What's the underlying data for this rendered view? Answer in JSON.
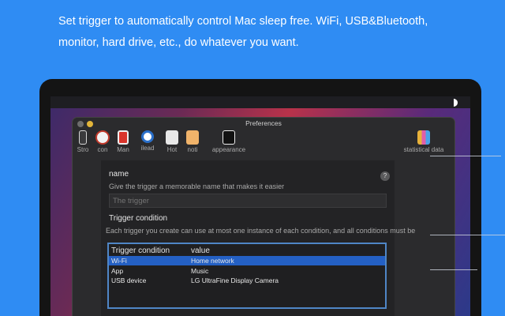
{
  "headline": "Set trigger to automatically control Mac sleep free. WiFi, USB&Bluetooth, monitor, hard drive, etc., do whatever you want.",
  "window": {
    "title": "Preferences"
  },
  "toolbar": {
    "items": [
      {
        "label": "Stro",
        "icon": "phone-icon"
      },
      {
        "label": "con",
        "icon": "clock-icon"
      },
      {
        "label": "Man",
        "icon": "power-icon"
      },
      {
        "label": "ilead",
        "icon": "search-icon"
      },
      {
        "label": "Hot",
        "icon": "keyboard-icon"
      },
      {
        "label": "noti",
        "icon": "notification-icon"
      },
      {
        "label": "appearance",
        "icon": "appearance-icon"
      },
      {
        "label": "statistical data",
        "icon": "bar-chart-icon"
      }
    ]
  },
  "form": {
    "name_label": "name",
    "name_hint": "Give the trigger a memorable name that makes it easier",
    "name_placeholder": "The trigger",
    "help": "?",
    "condition_label": "Trigger condition",
    "condition_hint": "Each trigger you create can use at most one instance of each condition, and all conditions must be"
  },
  "table": {
    "headers": [
      "Trigger condition",
      "value"
    ],
    "rows": [
      {
        "condition": "Wi-Fi",
        "value": "Home network",
        "selected": true
      },
      {
        "condition": "App",
        "value": "Music",
        "selected": false
      },
      {
        "condition": "USB device",
        "value": "LG UltraFine Display Camera",
        "selected": false
      }
    ]
  },
  "colors": {
    "background": "#2f8cf3",
    "selection": "#2460c4",
    "table_focus": "#4f86c6"
  }
}
